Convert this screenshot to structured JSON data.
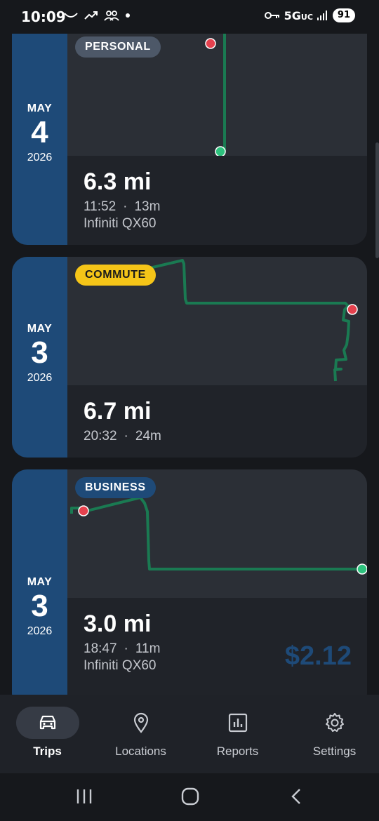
{
  "status": {
    "time": "10:09",
    "network": "5G",
    "network_suffix": "UC",
    "battery": "91"
  },
  "trips": [
    {
      "month": "MAY",
      "day": "4",
      "year": "2026",
      "tag": "PERSONAL",
      "distance": "6.3 mi",
      "time": "11:52",
      "duration": "13m",
      "vehicle": "Infiniti QX60",
      "amount": ""
    },
    {
      "month": "MAY",
      "day": "3",
      "year": "2026",
      "tag": "COMMUTE",
      "distance": "6.7 mi",
      "time": "20:32",
      "duration": "24m",
      "vehicle": "",
      "amount": ""
    },
    {
      "month": "MAY",
      "day": "3",
      "year": "2026",
      "tag": "BUSINESS",
      "distance": "3.0 mi",
      "time": "18:47",
      "duration": "11m",
      "vehicle": "Infiniti QX60",
      "amount": "$2.12"
    }
  ],
  "separator": "·",
  "nav": {
    "items": [
      {
        "label": "Trips",
        "icon": "car-icon",
        "active": true
      },
      {
        "label": "Locations",
        "icon": "location-pin-icon",
        "active": false
      },
      {
        "label": "Reports",
        "icon": "bar-chart-icon",
        "active": false
      },
      {
        "label": "Settings",
        "icon": "gear-icon",
        "active": false
      }
    ]
  },
  "colors": {
    "route": "#1a7a52",
    "start_marker": "#2ec27e",
    "end_marker": "#e5414e",
    "date_column": "#1e4a78",
    "commute_tag": "#f5c518",
    "personal_tag": "#4d5868"
  }
}
